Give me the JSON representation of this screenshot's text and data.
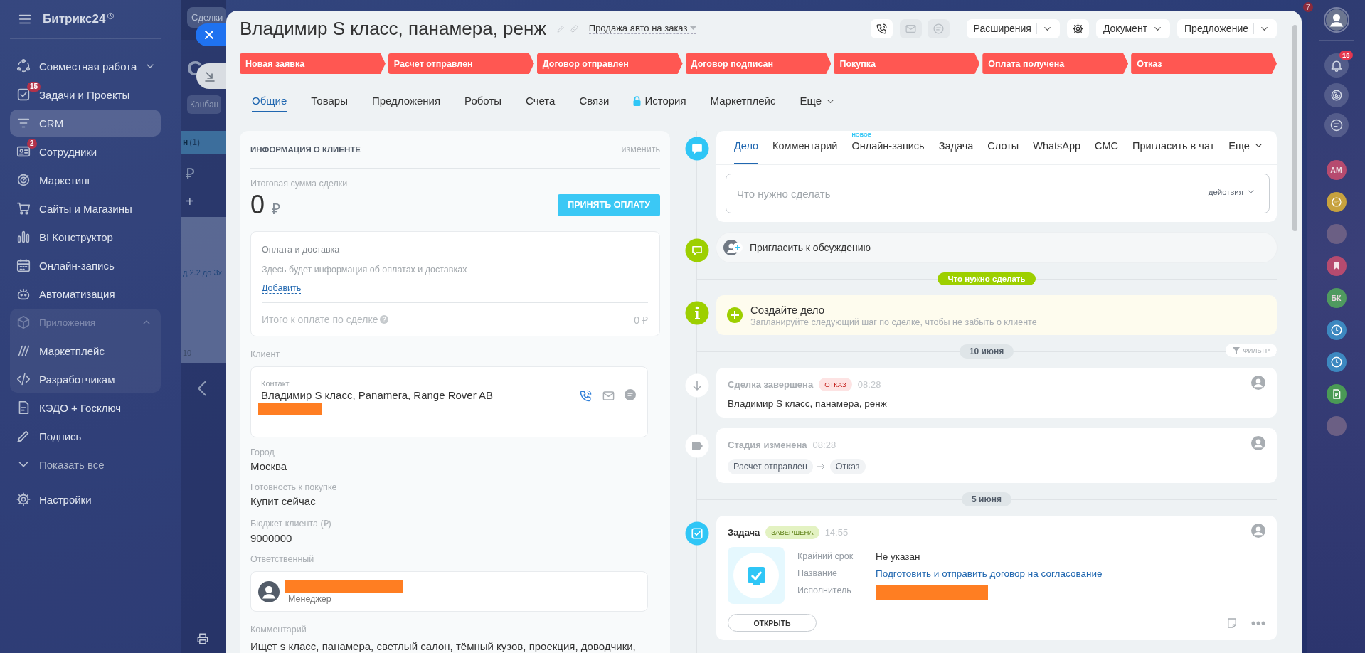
{
  "backdrop": {
    "button": "Сделки",
    "heading": "С",
    "view_switch": "Канбан",
    "column_title": "н",
    "column_count": "(1)",
    "column_sum": "₽",
    "add": "+",
    "card_text": "д 2.2 до 3х",
    "card_value": "10"
  },
  "sidebar": {
    "title": "Битрикс24",
    "items": [
      {
        "label": "Совместная работа",
        "kind": "expandable",
        "expanded": false,
        "selected": false
      },
      {
        "label": "Задачи и Проекты",
        "kind": "item",
        "badge": "15",
        "selected": false
      },
      {
        "label": "CRM",
        "kind": "item",
        "selected": true
      },
      {
        "label": "Сотрудники",
        "kind": "item",
        "badge": "2",
        "selected": false
      },
      {
        "label": "Маркетинг",
        "kind": "item",
        "selected": false
      },
      {
        "label": "Сайты и Магазины",
        "kind": "item",
        "selected": false
      },
      {
        "label": "BI Конструктор",
        "kind": "item",
        "selected": false
      },
      {
        "label": "Онлайн-запись",
        "kind": "item",
        "selected": false
      },
      {
        "label": "Автоматизация",
        "kind": "item",
        "selected": false
      },
      {
        "label": "Приложения",
        "kind": "group",
        "expanded": true,
        "selected": false,
        "children": [
          {
            "label": "Маркетплейс",
            "kind": "item",
            "selected": false
          },
          {
            "label": "Разработчикам",
            "kind": "item",
            "selected": false
          }
        ]
      },
      {
        "label": "КЭДО + Госключ",
        "kind": "item",
        "selected": false
      },
      {
        "label": "Подпись",
        "kind": "item",
        "selected": false
      },
      {
        "label": "Показать все",
        "kind": "more",
        "selected": false
      },
      {
        "label": "Настройки",
        "kind": "settings",
        "selected": false
      }
    ]
  },
  "deal_header": {
    "title": "Владимир S класс, панамера, ренж",
    "pipeline": "Продажа авто на заказ",
    "toolbar": [
      {
        "kind": "icon",
        "disabled": false
      },
      {
        "kind": "icon",
        "disabled": true
      },
      {
        "kind": "icon",
        "disabled": true
      },
      {
        "kind": "split",
        "label": "Расширения"
      },
      {
        "kind": "icon",
        "disabled": false
      },
      {
        "kind": "dropdown",
        "label": "Документ"
      },
      {
        "kind": "split",
        "label": "Предложение"
      }
    ]
  },
  "stages": [
    "Новая заявка",
    "Расчет отправлен",
    "Договор отправлен",
    "Договор подписан",
    "Покупка",
    "Оплата получена",
    "Отказ"
  ],
  "tabs": [
    {
      "label": "Общие",
      "kind": "tab",
      "selected": true
    },
    {
      "label": "Товары",
      "kind": "tab",
      "selected": false
    },
    {
      "label": "Предложения",
      "kind": "tab",
      "selected": false
    },
    {
      "label": "Роботы",
      "kind": "tab",
      "selected": false
    },
    {
      "label": "Счета",
      "kind": "tab",
      "selected": false
    },
    {
      "label": "Связи",
      "kind": "tab",
      "selected": false
    },
    {
      "label": "История",
      "kind": "locked",
      "selected": false
    },
    {
      "label": "Маркетплейс",
      "kind": "tab",
      "selected": false
    },
    {
      "label": "Еще",
      "kind": "menu",
      "selected": false
    }
  ],
  "client_panel": {
    "title": "ИНФОРМАЦИЯ О КЛИЕНТЕ",
    "edit_link": "изменить",
    "total_label": "Итоговая сумма сделки",
    "total_amount": "0",
    "currency": "₽",
    "pay_button": "ПРИНЯТЬ ОПЛАТУ",
    "payment": {
      "title": "Оплата и доставка",
      "empty_text": "Здесь будет информация об оплатах и доставках",
      "add_link": "Добавить",
      "due_label": "Итого к оплате по сделке",
      "due_amount": "0 ₽"
    },
    "client_label": "Клиент",
    "contact": {
      "label": "Контакт",
      "name": "Владимир S класс, Panamera, Range Rover AB"
    },
    "fields": [
      {
        "label": "Город",
        "value": "Москва"
      },
      {
        "label": "Готовность к покупке",
        "value": "Купит сейчас"
      },
      {
        "label": "Бюджет клиента (₽)",
        "value": "9000000"
      }
    ],
    "responsible": {
      "label": "Ответственный",
      "role": "Менеджер"
    },
    "comment": {
      "label": "Комментарий",
      "value": "Ищет s класс, панамера, светлый салон, тёмный кузов, проекция, доводчики,"
    }
  },
  "timeline": {
    "composer": {
      "tabs": [
        {
          "label": "Дело",
          "kind": "tab",
          "selected": true
        },
        {
          "label": "Комментарий",
          "kind": "tab",
          "selected": false
        },
        {
          "label": "Онлайн-запись",
          "kind": "tab",
          "badge": "НОВОЕ",
          "selected": false
        },
        {
          "label": "Задача",
          "kind": "tab",
          "selected": false
        },
        {
          "label": "Слоты",
          "kind": "tab",
          "selected": false
        },
        {
          "label": "WhatsApp",
          "kind": "tab",
          "selected": false
        },
        {
          "label": "СМС",
          "kind": "tab",
          "selected": false
        },
        {
          "label": "Пригласить в чат",
          "kind": "tab",
          "selected": false
        },
        {
          "label": "Еще",
          "kind": "menu",
          "selected": false
        }
      ],
      "placeholder": "Что нужно сделать",
      "actions": "действия"
    },
    "invite": "Пригласить к обсуждению",
    "section_label": "Что нужно сделать",
    "suggestion": {
      "title": "Создайте дело",
      "text": "Запланируйте следующий шаг по сделке, чтобы не забыть о клиенте"
    },
    "filter": "ФИЛЬТР",
    "groups": [
      {
        "date": "10 июня",
        "events": [
          {
            "kind": "deal_closed",
            "title": "Сделка завершена",
            "badge": "ОТКАЗ",
            "time": "08:28",
            "text": "Владимир S класс, панамера, ренж"
          },
          {
            "kind": "stage_changed",
            "title": "Стадия изменена",
            "time": "08:28",
            "from": "Расчет отправлен",
            "to": "Отказ"
          }
        ]
      },
      {
        "date": "5 июня",
        "events": [
          {
            "kind": "task",
            "title": "Задача",
            "badge": "ЗАВЕРШЕНА",
            "time": "14:55",
            "fields": [
              {
                "label": "Крайний срок",
                "kind": "text",
                "value": "Не указан"
              },
              {
                "label": "Название",
                "kind": "link",
                "value": "Подготовить и отправить договор на согласование"
              },
              {
                "label": "Исполнитель",
                "kind": "redacted"
              }
            ],
            "button": "ОТКРЫТЬ"
          }
        ]
      }
    ]
  },
  "right_bar": {
    "counter": "7",
    "notifications": "18",
    "items": [
      {
        "kind": "initials",
        "text": "АМ",
        "color": "#b64b6f"
      },
      {
        "kind": "chat",
        "color": "#c7a23e"
      },
      {
        "kind": "photo"
      },
      {
        "kind": "bookmark",
        "color": "#b64b6f"
      },
      {
        "kind": "initials",
        "text": "БК",
        "color": "#4f9a5f"
      },
      {
        "kind": "clock",
        "color": "#3d88c0"
      },
      {
        "kind": "clock",
        "color": "#3d88c0"
      },
      {
        "kind": "document",
        "color": "#4a9a55"
      },
      {
        "kind": "photo"
      }
    ]
  }
}
